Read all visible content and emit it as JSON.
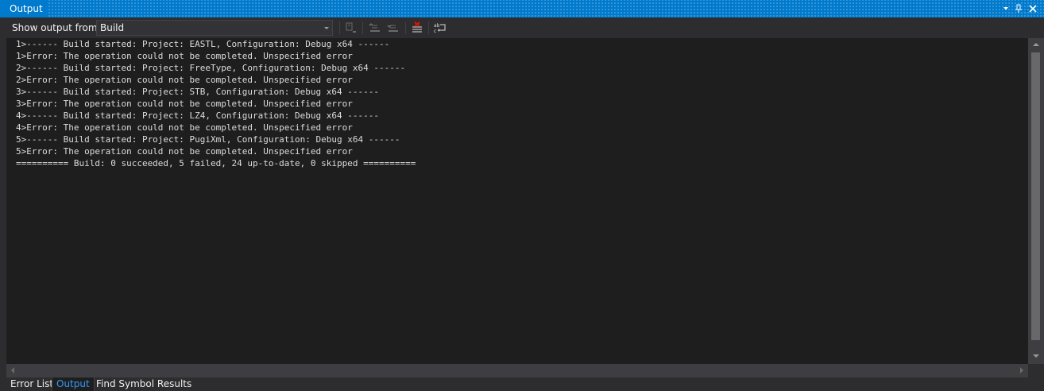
{
  "window": {
    "title": "Output",
    "controls": [
      "dropdown-arrow-icon",
      "pin-icon",
      "close-icon"
    ]
  },
  "toolbar": {
    "show_output_label": "Show output from:",
    "source_value": "Build",
    "icons": [
      "find-message-icon",
      "previous-message-icon",
      "next-message-icon",
      "clear-all-icon",
      "word-wrap-icon"
    ]
  },
  "output": {
    "lines": [
      "1>------ Build started: Project: EASTL, Configuration: Debug x64 ------",
      "1>Error: The operation could not be completed. Unspecified error",
      "2>------ Build started: Project: FreeType, Configuration: Debug x64 ------",
      "2>Error: The operation could not be completed. Unspecified error",
      "3>------ Build started: Project: STB, Configuration: Debug x64 ------",
      "3>Error: The operation could not be completed. Unspecified error",
      "4>------ Build started: Project: LZ4, Configuration: Debug x64 ------",
      "4>Error: The operation could not be completed. Unspecified error",
      "5>------ Build started: Project: PugiXml, Configuration: Debug x64 ------",
      "5>Error: The operation could not be completed. Unspecified error",
      "========== Build: 0 succeeded, 5 failed, 24 up-to-date, 0 skipped =========="
    ]
  },
  "tabs": [
    {
      "label": "Error List",
      "active": false
    },
    {
      "label": "Output",
      "active": true
    },
    {
      "label": "Find Symbol Results",
      "active": false
    }
  ],
  "colors": {
    "accent": "#007acc",
    "background": "#2d2d30",
    "editor_background": "#1e1e1e",
    "text": "#dcdcdc",
    "active_tab_text": "#3399ff"
  }
}
